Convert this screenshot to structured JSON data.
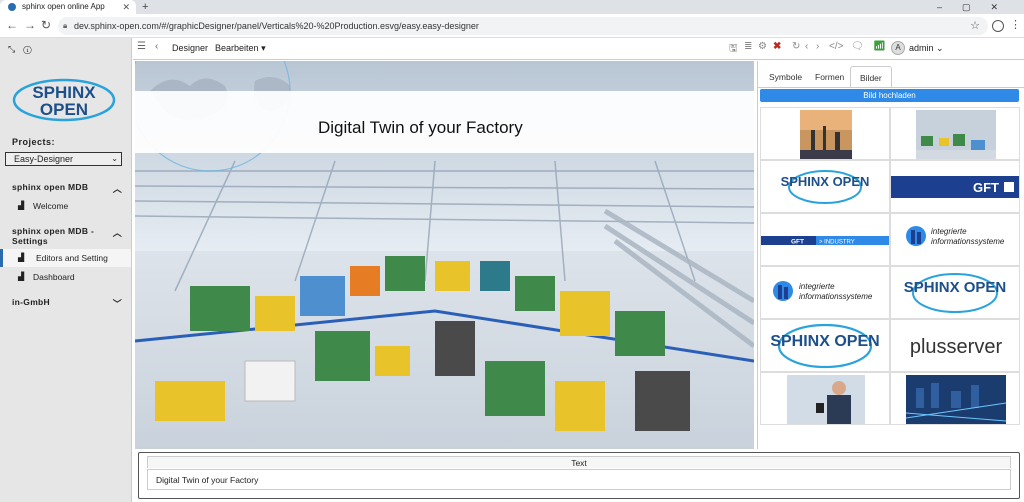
{
  "browser": {
    "tab_title": "sphinx open online App",
    "url": "dev.sphinx-open.com/#/graphicDesigner/panel/Verticals%20-%20Production.esvg/easy.easy-designer"
  },
  "sidebar": {
    "logo_text": "SPHINX OPEN",
    "projects_label": "Projects:",
    "project_selected": "Easy-Designer",
    "groups": [
      {
        "label": "sphinx open MDB",
        "items": [
          {
            "label": "Welcome"
          }
        ]
      },
      {
        "label": "sphinx open MDB - Settings",
        "items": [
          {
            "label": "Editors and Setting",
            "active": true
          },
          {
            "label": "Dashboard"
          }
        ]
      },
      {
        "label": "in-GmbH",
        "items": []
      }
    ]
  },
  "toolbar": {
    "designer_label": "Designer",
    "edit_menu_label": "Bearbeiten",
    "user_initial": "A",
    "user_name": "admin"
  },
  "canvas": {
    "headline": "Digital Twin of your Factory"
  },
  "right_panel": {
    "tabs": [
      {
        "label": "Symbole",
        "active": false
      },
      {
        "label": "Formen",
        "active": false
      },
      {
        "label": "Bilder",
        "active": true
      }
    ],
    "upload_label": "Bild hochladen",
    "images": [
      {
        "kind": "photo",
        "name": "refinery-photo"
      },
      {
        "kind": "photo",
        "name": "factory-photo"
      },
      {
        "kind": "logo",
        "name": "sphinx-open-logo",
        "text": "SPHINX OPEN"
      },
      {
        "kind": "logo",
        "name": "gft-logo",
        "text": "GFT"
      },
      {
        "kind": "logo",
        "name": "gft-industry-logo",
        "text_a": "GFT",
        "text_b": "> INDUSTRY"
      },
      {
        "kind": "logo",
        "name": "integrierte-logo-1",
        "text_a": "integrierte",
        "text_b": "informationssysteme"
      },
      {
        "kind": "logo",
        "name": "integrierte-logo-2",
        "text_a": "integrierte",
        "text_b": "informationssysteme"
      },
      {
        "kind": "logo",
        "name": "sphinx-open-logo-2",
        "text": "SPHINX OPEN"
      },
      {
        "kind": "logo",
        "name": "sphinx-open-logo-3",
        "text": "SPHINX OPEN"
      },
      {
        "kind": "logo",
        "name": "plusserver-logo",
        "text": "plusserver"
      },
      {
        "kind": "photo",
        "name": "businessman-photo"
      },
      {
        "kind": "photo",
        "name": "city-network-photo"
      }
    ]
  },
  "text_panel": {
    "header": "Text",
    "value": "Digital Twin of your Factory"
  },
  "colors": {
    "accent_blue": "#2e8ae6",
    "sidebar_bg": "#e6e6e6",
    "delete_red": "#c0281f"
  }
}
